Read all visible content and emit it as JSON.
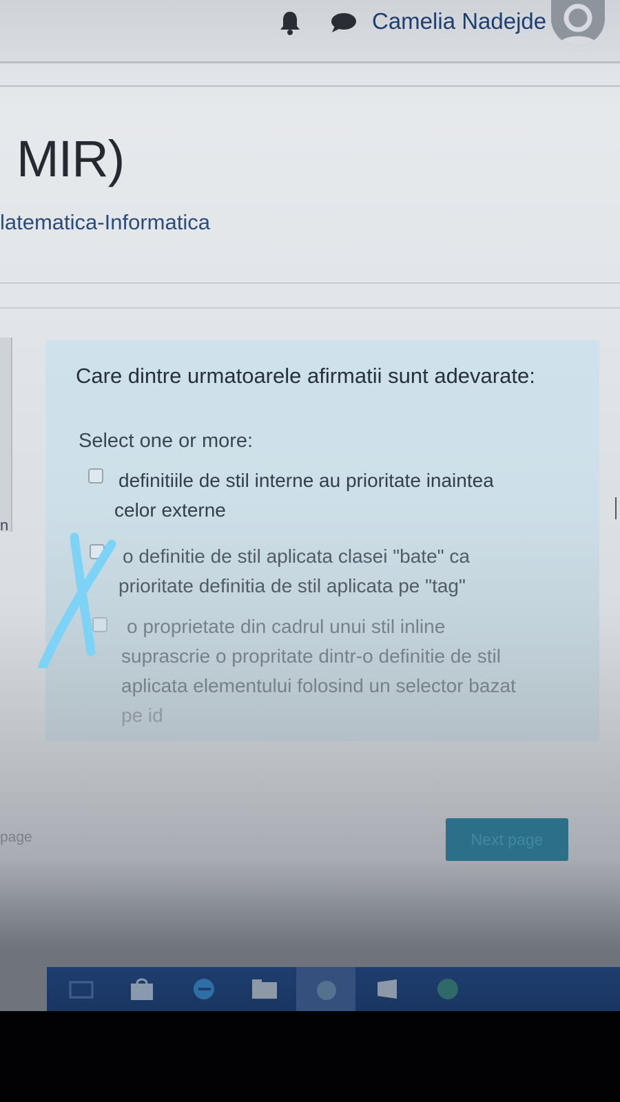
{
  "header": {
    "username": "Camelia Nadejde",
    "icons": [
      "bell-icon",
      "chat-icon",
      "user-avatar-icon"
    ]
  },
  "page": {
    "title": "MIR)",
    "course_link": "latematica-Informatica",
    "left_panel_fragment": "n"
  },
  "question": {
    "text": "Care dintre urmatoarele afirmatii sunt adevarate:",
    "prompt": "Select one or more:",
    "options": [
      {
        "line1": "definitiile de stil interne au prioritate inaintea",
        "line2": "celor externe",
        "line3": "",
        "line4": "",
        "checked": false
      },
      {
        "line1": "o definitie de stil aplicata clasei \"bate\" ca",
        "line2": "prioritate definitia de stil aplicata pe \"tag\"",
        "line3": "",
        "line4": "",
        "checked": false
      },
      {
        "line1": "o proprietate din cadrul unui stil inline",
        "line2": "suprascrie o propritate dintr-o definitie de stil",
        "line3": "aplicata elementului folosind un selector bazat",
        "line4": "pe id",
        "checked": false
      }
    ]
  },
  "navigation": {
    "previous_label": "page",
    "next_label": "Next page"
  },
  "colors": {
    "question_bg": "#cfe1ea",
    "next_button": "#2c6f88",
    "taskbar": "#1e3e70",
    "cross_mark": "#7dd3f5"
  },
  "taskbar": {
    "items": [
      "task-view-icon",
      "store-icon",
      "edge-icon",
      "file-explorer-icon",
      "app-icon",
      "app-icon-2",
      "app-icon-3"
    ]
  }
}
